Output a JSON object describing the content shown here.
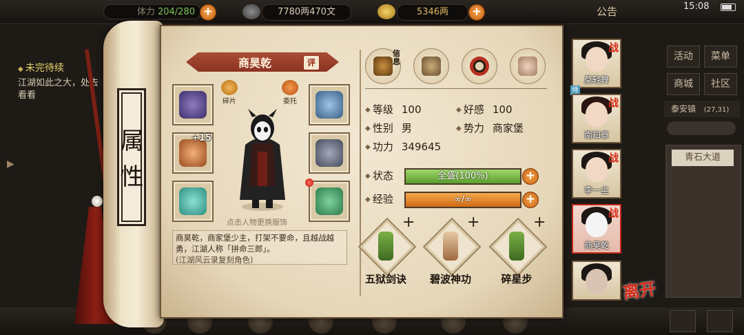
{
  "topbar": {
    "stamina": "204/280",
    "stamina_prefix": "体力",
    "money": "7780两470文",
    "ingots": "5346两",
    "notice": "公告",
    "clock": "15:08"
  },
  "quest": {
    "title": "未完待续",
    "desc": "江湖如此之大，处去看看"
  },
  "side": {
    "btn_activity": "活动",
    "btn_menu": "菜单",
    "btn_guild": "商城",
    "btn_community": "社区",
    "town": "泰安镇",
    "coords": "(27,31)",
    "location": "青石大道"
  },
  "scroll_label": "属性",
  "character": {
    "name": "商昊乾",
    "rate_label": "评",
    "fragment_label": "碎片",
    "entrust_label": "委托",
    "enhance_level": "+15",
    "hint": "点击人物更换服饰",
    "description": "商昊乾，商家堡少主，打架不要命，且越战越勇，江湖人称「拼命三郎」。",
    "source": "(江湖风云录复刻角色)"
  },
  "top_icons": {
    "info_tag": "信息"
  },
  "stats": {
    "level_label": "等级",
    "level": "100",
    "favor_label": "好感",
    "favor": "100",
    "gender_label": "性别",
    "gender": "男",
    "faction_label": "势力",
    "faction": "商家堡",
    "power_label": "功力",
    "power": "349645",
    "status_label": "状态",
    "status_text": "全盛(100%)",
    "status_fraction": 1.0,
    "exp_label": "经验",
    "exp_text": "∞/∞",
    "exp_fraction": 1.0
  },
  "skills": [
    {
      "name": "五狱剑诀"
    },
    {
      "name": "碧波神功"
    },
    {
      "name": "碎星步"
    }
  ],
  "team": [
    {
      "name": "莫轻舞",
      "tag": "战"
    },
    {
      "name": "南知意",
      "tag": "战"
    },
    {
      "name": "李一尘",
      "tag": "战"
    },
    {
      "name": "商昊乾",
      "tag": "战"
    },
    {
      "name": "",
      "tag": ""
    }
  ],
  "pet_tag": "侍",
  "leave_label": "离开",
  "colors": {
    "accent_orange": "#e0801c",
    "status_green": "#7bc04a",
    "exp_orange": "#e88a22",
    "battle_red": "#d62a17"
  }
}
